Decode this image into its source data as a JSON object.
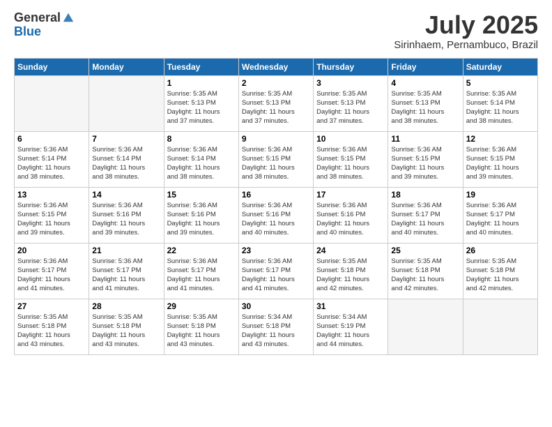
{
  "logo": {
    "general": "General",
    "blue": "Blue"
  },
  "title": "July 2025",
  "location": "Sirinhaem, Pernambuco, Brazil",
  "headers": [
    "Sunday",
    "Monday",
    "Tuesday",
    "Wednesday",
    "Thursday",
    "Friday",
    "Saturday"
  ],
  "weeks": [
    [
      {
        "day": "",
        "info": ""
      },
      {
        "day": "",
        "info": ""
      },
      {
        "day": "1",
        "info": "Sunrise: 5:35 AM\nSunset: 5:13 PM\nDaylight: 11 hours\nand 37 minutes."
      },
      {
        "day": "2",
        "info": "Sunrise: 5:35 AM\nSunset: 5:13 PM\nDaylight: 11 hours\nand 37 minutes."
      },
      {
        "day": "3",
        "info": "Sunrise: 5:35 AM\nSunset: 5:13 PM\nDaylight: 11 hours\nand 37 minutes."
      },
      {
        "day": "4",
        "info": "Sunrise: 5:35 AM\nSunset: 5:13 PM\nDaylight: 11 hours\nand 38 minutes."
      },
      {
        "day": "5",
        "info": "Sunrise: 5:35 AM\nSunset: 5:14 PM\nDaylight: 11 hours\nand 38 minutes."
      }
    ],
    [
      {
        "day": "6",
        "info": "Sunrise: 5:36 AM\nSunset: 5:14 PM\nDaylight: 11 hours\nand 38 minutes."
      },
      {
        "day": "7",
        "info": "Sunrise: 5:36 AM\nSunset: 5:14 PM\nDaylight: 11 hours\nand 38 minutes."
      },
      {
        "day": "8",
        "info": "Sunrise: 5:36 AM\nSunset: 5:14 PM\nDaylight: 11 hours\nand 38 minutes."
      },
      {
        "day": "9",
        "info": "Sunrise: 5:36 AM\nSunset: 5:15 PM\nDaylight: 11 hours\nand 38 minutes."
      },
      {
        "day": "10",
        "info": "Sunrise: 5:36 AM\nSunset: 5:15 PM\nDaylight: 11 hours\nand 38 minutes."
      },
      {
        "day": "11",
        "info": "Sunrise: 5:36 AM\nSunset: 5:15 PM\nDaylight: 11 hours\nand 39 minutes."
      },
      {
        "day": "12",
        "info": "Sunrise: 5:36 AM\nSunset: 5:15 PM\nDaylight: 11 hours\nand 39 minutes."
      }
    ],
    [
      {
        "day": "13",
        "info": "Sunrise: 5:36 AM\nSunset: 5:15 PM\nDaylight: 11 hours\nand 39 minutes."
      },
      {
        "day": "14",
        "info": "Sunrise: 5:36 AM\nSunset: 5:16 PM\nDaylight: 11 hours\nand 39 minutes."
      },
      {
        "day": "15",
        "info": "Sunrise: 5:36 AM\nSunset: 5:16 PM\nDaylight: 11 hours\nand 39 minutes."
      },
      {
        "day": "16",
        "info": "Sunrise: 5:36 AM\nSunset: 5:16 PM\nDaylight: 11 hours\nand 40 minutes."
      },
      {
        "day": "17",
        "info": "Sunrise: 5:36 AM\nSunset: 5:16 PM\nDaylight: 11 hours\nand 40 minutes."
      },
      {
        "day": "18",
        "info": "Sunrise: 5:36 AM\nSunset: 5:17 PM\nDaylight: 11 hours\nand 40 minutes."
      },
      {
        "day": "19",
        "info": "Sunrise: 5:36 AM\nSunset: 5:17 PM\nDaylight: 11 hours\nand 40 minutes."
      }
    ],
    [
      {
        "day": "20",
        "info": "Sunrise: 5:36 AM\nSunset: 5:17 PM\nDaylight: 11 hours\nand 41 minutes."
      },
      {
        "day": "21",
        "info": "Sunrise: 5:36 AM\nSunset: 5:17 PM\nDaylight: 11 hours\nand 41 minutes."
      },
      {
        "day": "22",
        "info": "Sunrise: 5:36 AM\nSunset: 5:17 PM\nDaylight: 11 hours\nand 41 minutes."
      },
      {
        "day": "23",
        "info": "Sunrise: 5:36 AM\nSunset: 5:17 PM\nDaylight: 11 hours\nand 41 minutes."
      },
      {
        "day": "24",
        "info": "Sunrise: 5:35 AM\nSunset: 5:18 PM\nDaylight: 11 hours\nand 42 minutes."
      },
      {
        "day": "25",
        "info": "Sunrise: 5:35 AM\nSunset: 5:18 PM\nDaylight: 11 hours\nand 42 minutes."
      },
      {
        "day": "26",
        "info": "Sunrise: 5:35 AM\nSunset: 5:18 PM\nDaylight: 11 hours\nand 42 minutes."
      }
    ],
    [
      {
        "day": "27",
        "info": "Sunrise: 5:35 AM\nSunset: 5:18 PM\nDaylight: 11 hours\nand 43 minutes."
      },
      {
        "day": "28",
        "info": "Sunrise: 5:35 AM\nSunset: 5:18 PM\nDaylight: 11 hours\nand 43 minutes."
      },
      {
        "day": "29",
        "info": "Sunrise: 5:35 AM\nSunset: 5:18 PM\nDaylight: 11 hours\nand 43 minutes."
      },
      {
        "day": "30",
        "info": "Sunrise: 5:34 AM\nSunset: 5:18 PM\nDaylight: 11 hours\nand 43 minutes."
      },
      {
        "day": "31",
        "info": "Sunrise: 5:34 AM\nSunset: 5:19 PM\nDaylight: 11 hours\nand 44 minutes."
      },
      {
        "day": "",
        "info": ""
      },
      {
        "day": "",
        "info": ""
      }
    ]
  ]
}
